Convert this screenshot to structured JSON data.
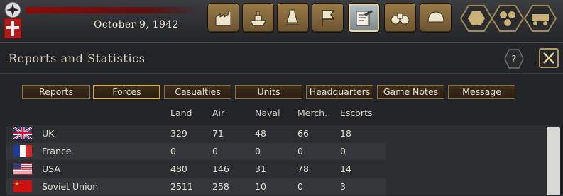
{
  "header": {
    "date": "October 9, 1942",
    "toolbar": [
      {
        "name": "production-icon"
      },
      {
        "name": "naval-icon"
      },
      {
        "name": "research-icon"
      },
      {
        "name": "diplomacy-flag-icon"
      },
      {
        "name": "reports-icon",
        "active": true
      },
      {
        "name": "intelligence-binoculars-icon"
      },
      {
        "name": "army-helmet-icon"
      }
    ],
    "hex_buttons": [
      {
        "name": "single-hex-icon"
      },
      {
        "name": "hex-cluster-icon"
      },
      {
        "name": "train-icon"
      }
    ]
  },
  "window": {
    "title": "Reports and Statistics",
    "help_label": "?",
    "tabs": [
      {
        "label": "Reports"
      },
      {
        "label": "Forces",
        "active": true
      },
      {
        "label": "Casualties"
      },
      {
        "label": "Units"
      },
      {
        "label": "Headquarters"
      },
      {
        "label": "Game Notes"
      },
      {
        "label": "Message"
      }
    ],
    "columns": [
      "Land",
      "Air",
      "Naval",
      "Merch.",
      "Escorts"
    ],
    "rows": [
      {
        "country": "UK",
        "flag": "uk-flag-icon",
        "land": "329",
        "air": "71",
        "naval": "48",
        "merch": "66",
        "escorts": "18"
      },
      {
        "country": "France",
        "flag": "france-flag-icon",
        "land": "0",
        "air": "0",
        "naval": "0",
        "merch": "0",
        "escorts": "0"
      },
      {
        "country": "USA",
        "flag": "usa-flag-icon",
        "land": "480",
        "air": "146",
        "naval": "31",
        "merch": "78",
        "escorts": "14"
      },
      {
        "country": "Soviet Union",
        "flag": "soviet-flag-icon",
        "land": "2511",
        "air": "258",
        "naval": "10",
        "merch": "0",
        "escorts": "3"
      }
    ]
  },
  "colors": {
    "accent_gold": "#d4ad56",
    "tab_bg": "#3e2d18",
    "panel_bg": "#2b2d30"
  }
}
